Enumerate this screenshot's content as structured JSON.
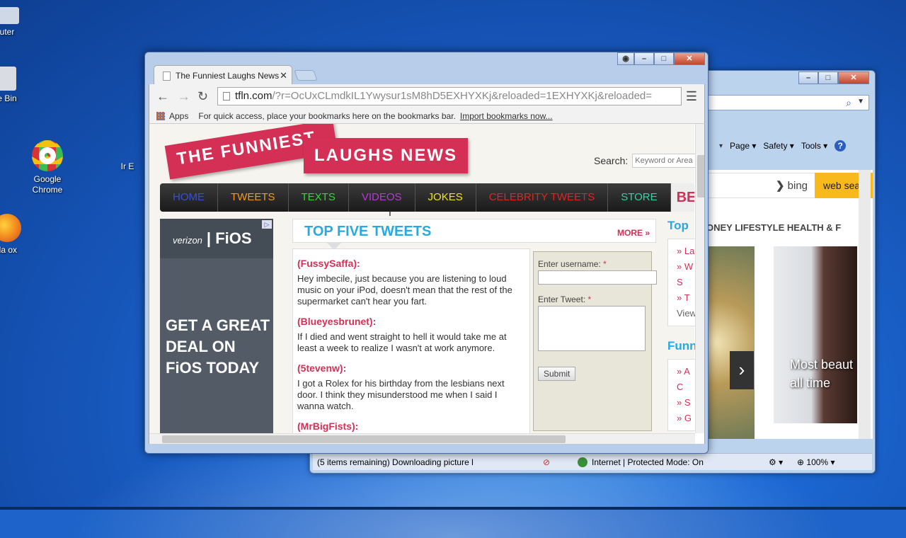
{
  "desktop": {
    "icons": [
      {
        "label": "uter"
      },
      {
        "label": "e Bin"
      },
      {
        "label": "Google Chrome"
      },
      {
        "label": "lla ox"
      },
      {
        "label": "Ir E"
      }
    ]
  },
  "ie_window": {
    "page_label": "Page ▾",
    "safety_label": "Safety ▾",
    "tools_label": "Tools ▾",
    "help_label": "?",
    "bing_label": "bing",
    "websearch_label": "web sear",
    "categories": "ONEY   LIFESTYLE   HEALTH & F",
    "caption": "Most beaut all time",
    "status_left": "(5 items remaining) Downloading picture l",
    "status_zone": "Internet | Protected Mode: On",
    "zoom": "100%"
  },
  "chrome_window": {
    "tab_title": "The Funniest Laughs News",
    "url_host": "tfln.com",
    "url_rest": "/?r=OcUxCLmdkIL1Ywysur1sM8hD5EXHYXKj&reloaded=1EXHYXKj&reloaded=",
    "bookmarks": {
      "apps": "Apps",
      "hint": "For quick access, place your bookmarks here on the bookmarks bar.",
      "import": "Import bookmarks now..."
    }
  },
  "site": {
    "logo_top": "THE FUNNIEST",
    "logo_bottom": "LAUGHS NEWS",
    "search_label": "Search:",
    "search_placeholder": "Keyword or Area",
    "nav": [
      {
        "label": "HOME",
        "color": "#3a4fd6"
      },
      {
        "label": "TWEETS",
        "color": "#f29a1f"
      },
      {
        "label": "TEXTS",
        "color": "#3bd23b"
      },
      {
        "label": "VIDEOS",
        "color": "#b33ad6"
      },
      {
        "label": "JOKES",
        "color": "#f2e21f"
      },
      {
        "label": "CELEBRITY TWEETS",
        "color": "#e02424"
      },
      {
        "label": "STORE",
        "color": "#2bd6a4"
      },
      {
        "label": "BES",
        "color": "#d42f55"
      }
    ],
    "ad": {
      "brand": "verizon",
      "product": "FiOS",
      "text": "GET A GREAT DEAL ON FiOS TODAY",
      "choice": "▷"
    },
    "top_five": {
      "title": "TOP FIVE TWEETS",
      "more": "MORE »"
    },
    "tweets": [
      {
        "handle": "(FussySaffa):",
        "text": "Hey imbecile, just because you are listening to loud music on your iPod, doesn't mean that the rest of the supermarket can't hear you fart."
      },
      {
        "handle": "(Blueyesbrunet):",
        "text": "If I died and went straight to hell it would take me at least a week to realize I wasn't at work anymore."
      },
      {
        "handle": "(5tevenw):",
        "text": "I got a Rolex for his birthday from the lesbians next door. I think they misunderstood me when I said I wanna watch."
      },
      {
        "handle": "(MrBigFists):",
        "text": ""
      }
    ],
    "form": {
      "username_label": "Enter username:",
      "tweet_label": "Enter Tweet:",
      "required": "*",
      "submit": "Submit"
    },
    "side": {
      "top_heading": "Top",
      "top_items": [
        "» La",
        "» W S",
        "» T"
      ],
      "view": "View",
      "funny_heading": "Funn",
      "funny_items": [
        "» A C",
        "» S",
        "» G"
      ]
    }
  }
}
